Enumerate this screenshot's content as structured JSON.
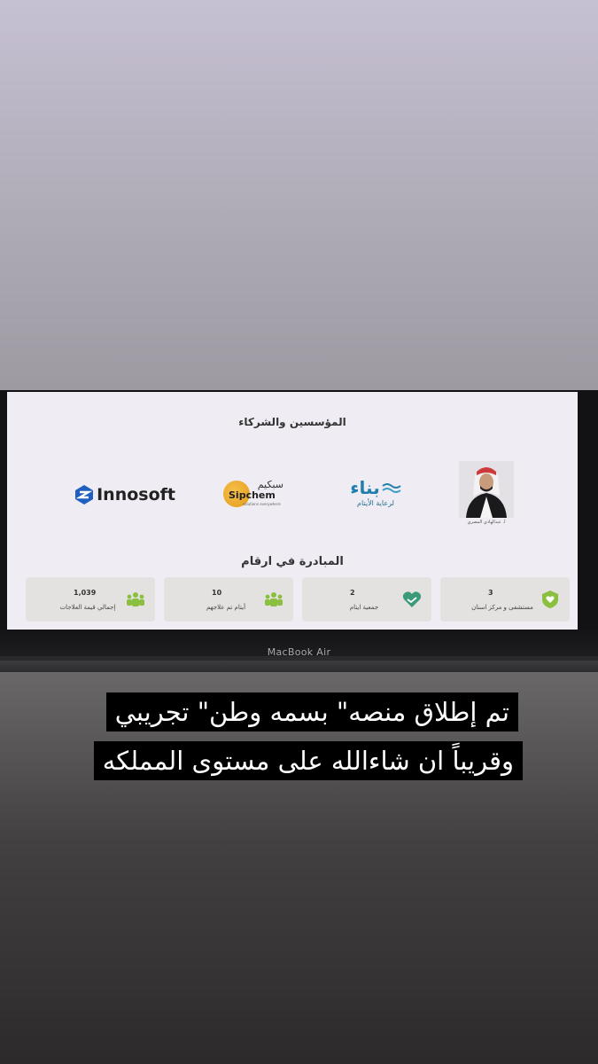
{
  "screen": {
    "partners_title": "المؤسسين والشركاء",
    "person_caption": "أ. عبدالهادي المصري",
    "logos": {
      "bina_main": "بناء",
      "bina_sub": "لرعاية الأيتام",
      "sipchem_arabic": "سبكيم",
      "sipchem_latin": "Sipchem",
      "sipchem_tagline": "solutions everywhere",
      "innosoft": "Innosoft"
    },
    "stats_title": "المبادرة في ارقام",
    "stats": [
      {
        "value": "3",
        "label": "مستشفى و مركز اسنان",
        "icon": "shield-heart-icon"
      },
      {
        "value": "2",
        "label": "جمعية ايتام",
        "icon": "heart-hands-icon"
      },
      {
        "value": "10",
        "label": "أيتام تم علاجهم",
        "icon": "people-group-icon"
      },
      {
        "value": "1,039",
        "label": "إجمالي قيمة العلاجات",
        "icon": "people-group-icon"
      }
    ],
    "accent_color": "#8bbf3f"
  },
  "laptop": {
    "brand": "MacBook Air"
  },
  "caption": {
    "line1": "تم إطلاق منصه\" بسمه وطن\" تجريبي",
    "line2": "وقريباً ان شاءالله على مستوى المملكه"
  }
}
